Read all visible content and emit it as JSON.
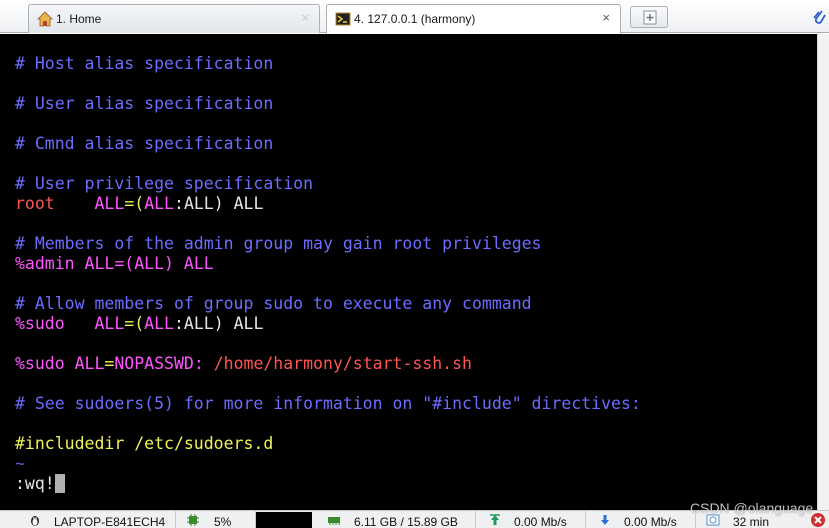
{
  "tabs": [
    {
      "label": "1. Home",
      "icon": "home-icon",
      "close": "×"
    },
    {
      "label": "4. 127.0.0.1 (harmony)",
      "icon": "terminal-icon",
      "close": "×"
    }
  ],
  "terminal": {
    "l1": "# Host alias specification",
    "l2": "# User alias specification",
    "l3": "# Cmnd alias specification",
    "l4": "# User privilege specification",
    "l5": {
      "user": "root",
      "pad": "    ",
      "all1": "ALL",
      "eq": "=(",
      "all2": "ALL",
      "colon": ":",
      "all3": "ALL) ALL"
    },
    "l6": "# Members of the admin group may gain root privileges",
    "l7": {
      "group": "%admin",
      "all1": "ALL",
      "rest": "=(ALL) ALL"
    },
    "l8": "# Allow members of group sudo to execute any command",
    "l9": {
      "group": "%sudo",
      "pad": "   ",
      "all1": "ALL",
      "eq": "=(",
      "all2": "ALL",
      "colon": ":",
      "all3": "ALL) ALL"
    },
    "l10": {
      "group": "%sudo",
      "all1": "ALL",
      "eq": "=",
      "nopass": "NOPASSWD:",
      "path": "/home/harmony/start-ssh.sh"
    },
    "l11": "# See sudoers(5) for more information on \"#include\" directives:",
    "l12": "#includedir /etc/sudoers.d",
    "tilde": "~",
    "command": ":wq!"
  },
  "status": {
    "host": "LAPTOP-E841ECH4",
    "cpu": "5%",
    "memory": "6.11 GB / 15.89 GB",
    "upload": "0.00 Mb/s",
    "download": "0.00 Mb/s",
    "uptime": "32 min"
  },
  "watermark": "CSDN @olanguage",
  "colors": {
    "comment": "#6c6cff",
    "keyword": "#ff55ff",
    "user": "#ff5555",
    "directive": "#f2f25a",
    "background": "#000000"
  }
}
